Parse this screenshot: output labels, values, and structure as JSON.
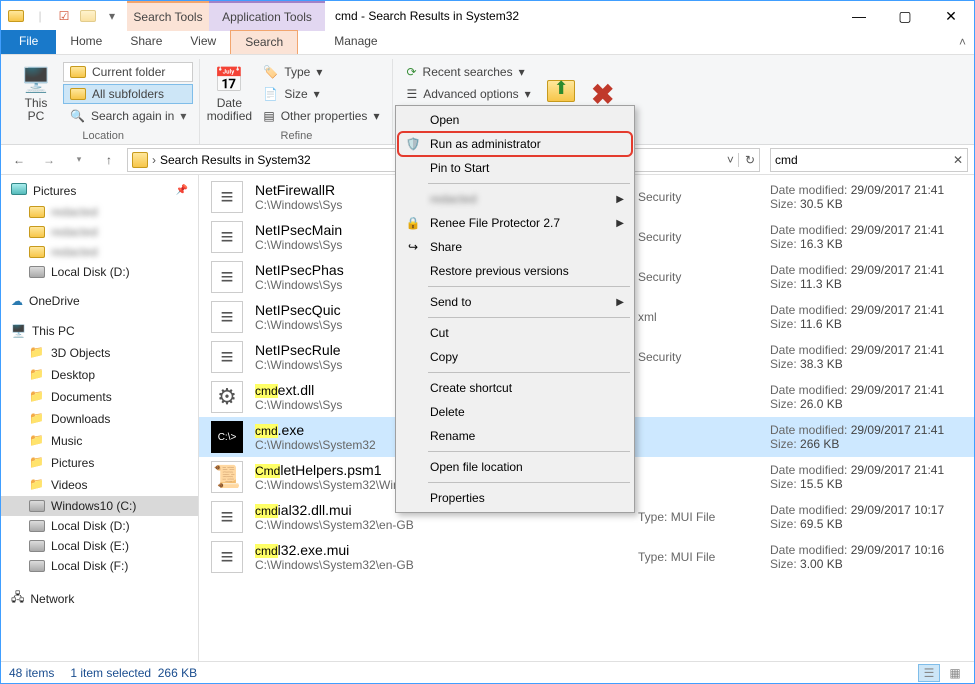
{
  "window": {
    "title": "cmd - Search Results in System32",
    "context_tabs": {
      "search": "Search Tools",
      "app": "Application Tools"
    }
  },
  "tabs": {
    "file": "File",
    "home": "Home",
    "share": "Share",
    "view": "View",
    "search": "Search",
    "manage": "Manage"
  },
  "ribbon": {
    "location": {
      "this_pc": "This\nPC",
      "current_folder": "Current folder",
      "all_subfolders": "All subfolders",
      "search_again_in": "Search again in",
      "group": "Location"
    },
    "refine": {
      "date_modified": "Date\nmodified",
      "type": "Type",
      "size": "Size",
      "other_properties": "Other properties",
      "group": "Refine"
    },
    "options": {
      "recent_searches": "Recent searches",
      "advanced_options": "Advanced options",
      "save_search": ""
    }
  },
  "address": {
    "path": "Search Results in System32",
    "refresh": "",
    "search_value": "cmd"
  },
  "sidebar": {
    "groups": [
      {
        "key": "pictures_q",
        "label": "Pictures",
        "icon": "pic",
        "pin": true,
        "items": [
          {
            "label": "redacted",
            "icon": "folder",
            "blur": true
          },
          {
            "label": "redacted",
            "icon": "folder",
            "blur": true
          },
          {
            "label": "redacted",
            "icon": "folder",
            "blur": true
          },
          {
            "label": "Local Disk (D:)",
            "icon": "disk"
          }
        ]
      },
      {
        "key": "onedrive",
        "label": "OneDrive",
        "icon": "cloud",
        "items": []
      },
      {
        "key": "thispc",
        "label": "This PC",
        "icon": "pc",
        "items": [
          {
            "label": "3D Objects",
            "icon": "generic"
          },
          {
            "label": "Desktop",
            "icon": "generic"
          },
          {
            "label": "Documents",
            "icon": "generic"
          },
          {
            "label": "Downloads",
            "icon": "generic"
          },
          {
            "label": "Music",
            "icon": "generic"
          },
          {
            "label": "Pictures",
            "icon": "generic"
          },
          {
            "label": "Videos",
            "icon": "generic"
          },
          {
            "label": "Windows10 (C:)",
            "icon": "disk",
            "selected": true
          },
          {
            "label": "Local Disk (D:)",
            "icon": "disk"
          },
          {
            "label": "Local Disk (E:)",
            "icon": "disk"
          },
          {
            "label": "Local Disk (F:)",
            "icon": "disk"
          }
        ]
      },
      {
        "key": "network",
        "label": "Network",
        "icon": "net",
        "items": []
      }
    ]
  },
  "files": [
    {
      "name_pre": "",
      "name_hl": "",
      "name_post": "NetFirewallR",
      "path": "C:\\Windows\\Sys",
      "type_pre": "",
      "type_post": "Security",
      "date": "29/09/2017 21:41",
      "size": "30.5 KB",
      "icon": "doc"
    },
    {
      "name_pre": "",
      "name_hl": "",
      "name_post": "NetIPsecMain",
      "path": "C:\\Windows\\Sys",
      "type_pre": "",
      "type_post": "Security",
      "date": "29/09/2017 21:41",
      "size": "16.3 KB",
      "icon": "doc"
    },
    {
      "name_pre": "",
      "name_hl": "",
      "name_post": "NetIPsecPhas",
      "path": "C:\\Windows\\Sys",
      "type_pre": "",
      "type_post": "Security",
      "date": "29/09/2017 21:41",
      "size": "11.3 KB",
      "icon": "doc"
    },
    {
      "name_pre": "",
      "name_hl": "",
      "name_post": "NetIPsecQuic",
      "path": "C:\\Windows\\Sys",
      "type_pre": "",
      "type_post": "xml",
      "date": "29/09/2017 21:41",
      "size": "11.6 KB",
      "icon": "doc"
    },
    {
      "name_pre": "",
      "name_hl": "",
      "name_post": "NetIPsecRule",
      "path": "C:\\Windows\\Sys",
      "type_pre": "",
      "type_post": "Security",
      "date": "29/09/2017 21:41",
      "size": "38.3 KB",
      "icon": "doc"
    },
    {
      "name_pre": "",
      "name_hl": "cmd",
      "name_post": "ext.dll",
      "path": "C:\\Windows\\Sys",
      "type_pre": "",
      "type_post": "",
      "date": "29/09/2017 21:41",
      "size": "26.0 KB",
      "icon": "dll"
    },
    {
      "name_pre": "",
      "name_hl": "cmd",
      "name_post": ".exe",
      "path": "C:\\Windows\\System32",
      "type_pre": "",
      "type_post": "",
      "date": "29/09/2017 21:41",
      "size": "266 KB",
      "icon": "cmd",
      "selected": true
    },
    {
      "name_pre": "",
      "name_hl": "Cmd",
      "name_post": "letHelpers.psm1",
      "path": "C:\\Windows\\System32\\WindowsPowerShell\\v1.0\\Modules\\NetworkS...",
      "type_pre": "",
      "type_post": "",
      "date": "29/09/2017 21:41",
      "size": "15.5 KB",
      "icon": "ps"
    },
    {
      "name_pre": "",
      "name_hl": "cmd",
      "name_post": "ial32.dll.mui",
      "path": "C:\\Windows\\System32\\en-GB",
      "type_pre": "Type: ",
      "type_post": "MUI File",
      "date": "29/09/2017 10:17",
      "size": "69.5 KB",
      "icon": "file"
    },
    {
      "name_pre": "",
      "name_hl": "cmd",
      "name_post": "l32.exe.mui",
      "path": "C:\\Windows\\System32\\en-GB",
      "type_pre": "Type: ",
      "type_post": "MUI File",
      "date": "29/09/2017 10:16",
      "size": "3.00 KB",
      "icon": "file"
    }
  ],
  "file_meta_labels": {
    "date": "Date modified:",
    "size": "Size:"
  },
  "context_menu": [
    {
      "label": "Open",
      "icon": ""
    },
    {
      "label": "Run as administrator",
      "icon": "shield",
      "highlight": true
    },
    {
      "label": "Pin to Start",
      "icon": ""
    },
    {
      "sep": true
    },
    {
      "label": "redacted",
      "blur": true,
      "submenu": true
    },
    {
      "label": "Renee File Protector 2.7",
      "icon": "lock",
      "submenu": true
    },
    {
      "label": "Share",
      "icon": "share"
    },
    {
      "label": "Restore previous versions"
    },
    {
      "sep": true
    },
    {
      "label": "Send to",
      "submenu": true
    },
    {
      "sep": true
    },
    {
      "label": "Cut"
    },
    {
      "label": "Copy"
    },
    {
      "sep": true
    },
    {
      "label": "Create shortcut"
    },
    {
      "label": "Delete"
    },
    {
      "label": "Rename"
    },
    {
      "sep": true
    },
    {
      "label": "Open file location"
    },
    {
      "sep": true
    },
    {
      "label": "Properties"
    }
  ],
  "status": {
    "items": "48 items",
    "selected": "1 item selected",
    "size": "266 KB"
  }
}
